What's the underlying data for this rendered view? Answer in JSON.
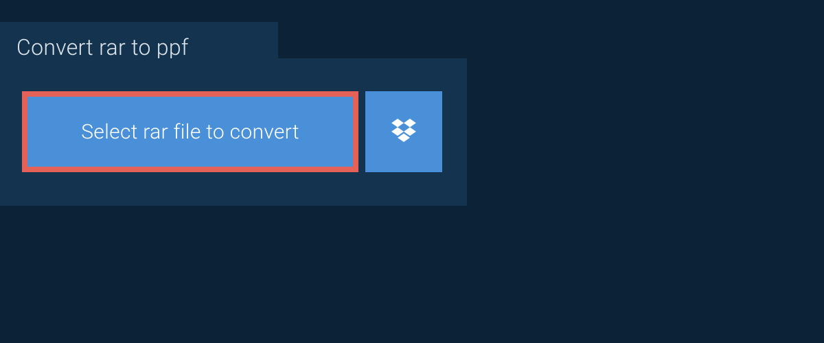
{
  "tab": {
    "title": "Convert rar to ppf"
  },
  "actions": {
    "select_file_label": "Select rar file to convert"
  },
  "colors": {
    "background": "#0c2236",
    "panel": "#14334e",
    "button": "#4a90d9",
    "highlight_border": "#e46157",
    "text_light": "#dde5ec",
    "text_white": "#ffffff"
  }
}
